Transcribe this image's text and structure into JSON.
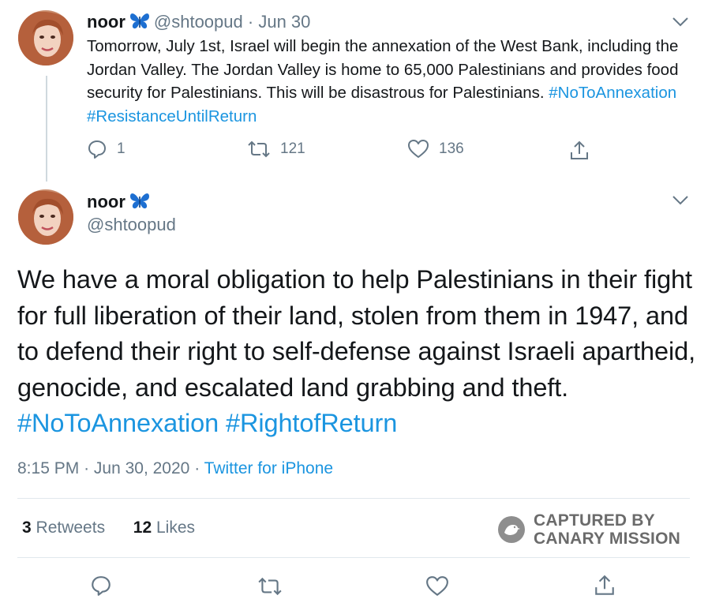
{
  "tweet1": {
    "display_name": "noor",
    "name_emoji_icon": "butterfly-icon",
    "handle": "@shtoopud",
    "separator": "·",
    "date": "Jun 30",
    "text": "Tomorrow, July 1st, Israel will begin the annexation of the West Bank, including the Jordan Valley. The Jordan Valley is home to 65,000 Palestinians and provides food security for Palestinians. This will be disastrous for Palestinians.",
    "hashtags": [
      "#NoToAnnexation",
      "#ResistanceUntilReturn"
    ],
    "replies": "1",
    "retweets": "121",
    "likes": "136"
  },
  "tweet2": {
    "display_name": "noor",
    "handle": "@shtoopud",
    "text": "We have a moral obligation to help Palestinians in their fight for full liberation of their land, stolen from them in 1947, and to defend their right to self-defense against Israeli apartheid, genocide, and escalated land grabbing and theft.",
    "hashtags": [
      "#NoToAnnexation",
      "#RightofReturn"
    ],
    "time": "8:15 PM",
    "separator": "·",
    "date": "Jun 30, 2020",
    "source": "Twitter for iPhone",
    "retweet_count": "3",
    "retweet_label": "Retweets",
    "like_count": "12",
    "like_label": "Likes"
  },
  "watermark": {
    "line1": "CAPTURED BY",
    "line2": "CANARY MISSION"
  },
  "colors": {
    "link": "#1b95e0",
    "muted": "#657786",
    "text": "#14171a",
    "divider": "#e1e8ed",
    "butterfly": "#1d6fd1"
  }
}
